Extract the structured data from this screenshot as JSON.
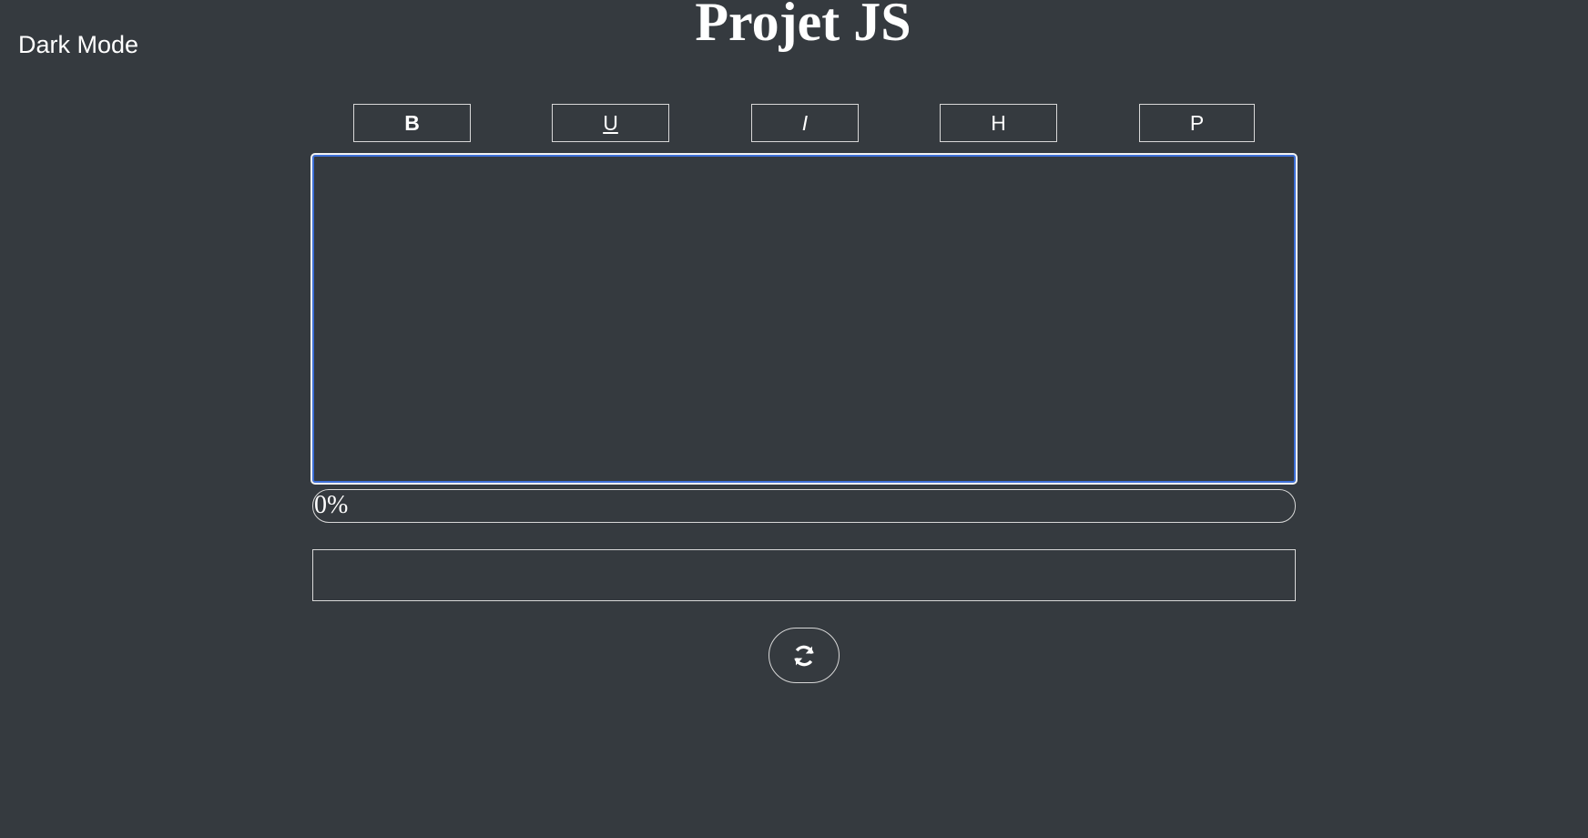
{
  "header": {
    "dark_mode_label": "Dark Mode",
    "title": "Projet JS"
  },
  "toolbar": {
    "bold_label": "B",
    "underline_label": "U",
    "italic_label": "I",
    "heading_label": "H",
    "paragraph_label": "P"
  },
  "editor": {
    "content": ""
  },
  "progress": {
    "value_percent": 0,
    "label": "0%"
  },
  "output": {
    "content": ""
  },
  "refresh": {
    "icon": "refresh-icon"
  },
  "colors": {
    "background": "#353a3f",
    "text": "#ffffff",
    "focus_accent": "#3d6fd8",
    "border": "#d8d8d8"
  }
}
